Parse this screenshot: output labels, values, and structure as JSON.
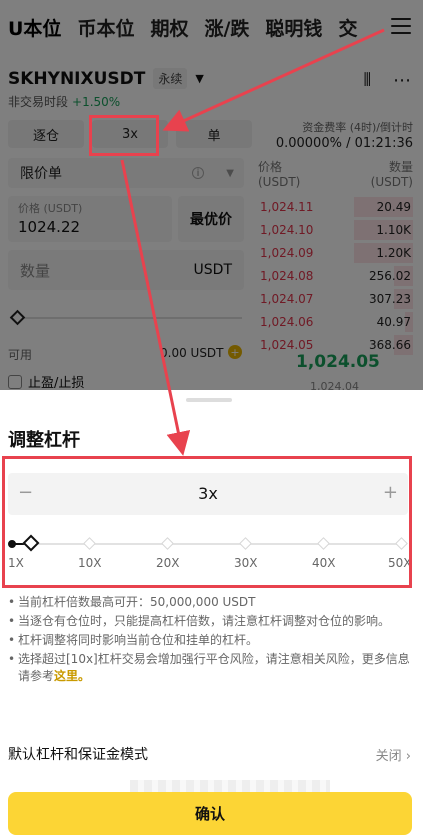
{
  "tabs": [
    "U本位",
    "币本位",
    "期权",
    "涨/跌",
    "聪明钱",
    "交"
  ],
  "symbol": "SKHYNIXUSDT",
  "contract_type": "永续",
  "session": "非交易时段",
  "change_pct": "+1.50%",
  "margin_mode": "逐仓",
  "leverage_chip": "3x",
  "side_mode": "单",
  "funding": {
    "label": "资金费率 (4时)/倒计时",
    "value": "0.00000% / 01:21:36"
  },
  "order_type": "限价单",
  "price": {
    "label": "价格 (USDT)",
    "value": "1024.22"
  },
  "best_price_label": "最优价",
  "quantity": {
    "placeholder": "数量",
    "unit": "USDT"
  },
  "available": {
    "label": "可用",
    "value": "0.00 USDT"
  },
  "tpsl_label": "止盈/止损",
  "orderbook": {
    "price_header": "价格\n(USDT)",
    "qty_header": "数量\n(USDT)",
    "asks": [
      {
        "price": "1,024.11",
        "qty": "20.49",
        "depth": 0.38
      },
      {
        "price": "1,024.10",
        "qty": "1.10K",
        "depth": 0.38
      },
      {
        "price": "1,024.09",
        "qty": "1.20K",
        "depth": 0.38
      },
      {
        "price": "1,024.08",
        "qty": "256.02",
        "depth": 0.12
      },
      {
        "price": "1,024.07",
        "qty": "307.23",
        "depth": 0.12
      },
      {
        "price": "1,024.06",
        "qty": "40.97",
        "depth": 0.05
      },
      {
        "price": "1,024.05",
        "qty": "368.66",
        "depth": 0.12
      }
    ],
    "mid_price": "1,024.05",
    "mid_sub": "1,024.04"
  },
  "sheet": {
    "title": "调整杠杆",
    "stepper_value": "3x",
    "slider_labels": [
      "1X",
      "10X",
      "20X",
      "30X",
      "40X",
      "50X"
    ],
    "slider_value": 3,
    "notes": [
      "当前杠杆倍数最高可开：50,000,000 USDT",
      "当逐仓有仓位时，只能提高杠杆倍数，请注意杠杆调整对仓位的影响。",
      "杠杆调整将同时影响当前仓位和挂单的杠杆。",
      "选择超过[10x]杠杆交易会增加强行平仓风险，请注意相关风险，更多信息请参考"
    ],
    "notes_link": "这里。",
    "default_label": "默认杠杆和保证金模式",
    "default_value": "关闭",
    "confirm_label": "确认"
  },
  "colors": {
    "accent": "#fcd535",
    "ask": "#e0344b",
    "bid": "#18a05a",
    "highlight": "#e8424e"
  }
}
